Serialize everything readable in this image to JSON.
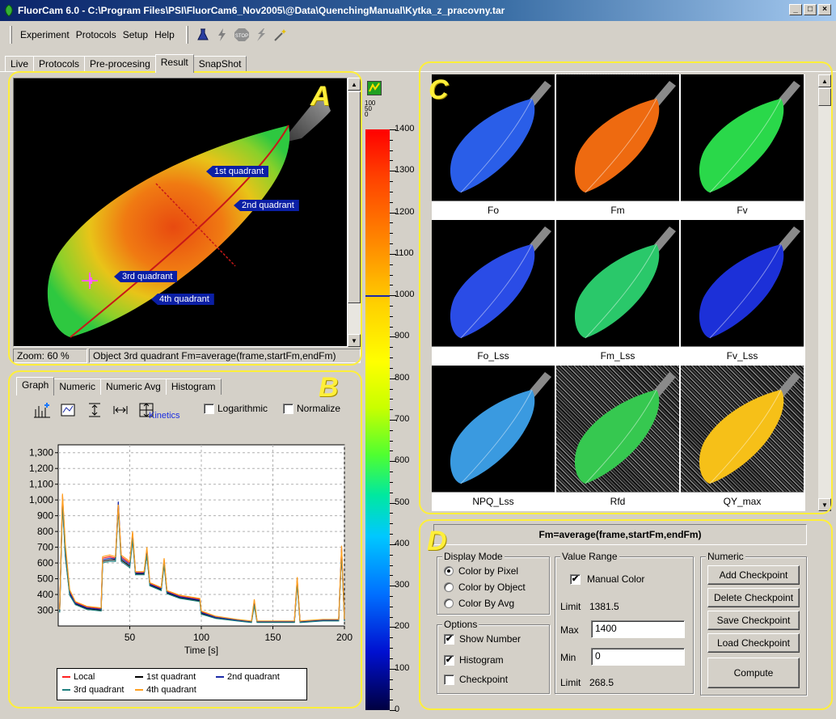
{
  "window": {
    "title": "FluorCam 6.0 - C:\\Program Files\\PSI\\FluorCam6_Nov2005\\@Data\\QuenchingManual\\Kytka_z_pracovny.tar",
    "min": "_",
    "max": "□",
    "close": "×"
  },
  "menu": [
    "Experiment",
    "Protocols",
    "Setup",
    "Help"
  ],
  "toolbar_icons": [
    "flask-icon",
    "flash-icon",
    "stop-icon",
    "lightning-icon",
    "wand-icon"
  ],
  "toolbar": {
    "stop_label": "STOP"
  },
  "main_tabs": [
    "Live",
    "Protocols",
    "Pre-procesing",
    "Result",
    "SnapShot"
  ],
  "active_main_tab": "Result",
  "panel_letters": {
    "a": "A",
    "b": "B",
    "c": "C",
    "d": "D"
  },
  "image_panel": {
    "quadrants": [
      "1st quadrant",
      "2nd quadrant",
      "3rd quadrant",
      "4th quadrant"
    ],
    "zoom": "Zoom: 60 %",
    "object_status": "Object 3rd quadrant  Fm=average(frame,startFm,endFm)"
  },
  "colorscale": {
    "icon_mini_labels": [
      "100",
      "50",
      "0"
    ],
    "ticks": [
      "1400",
      "1300",
      "1200",
      "1100",
      "1000",
      "900",
      "800",
      "700",
      "600",
      "500",
      "400",
      "300",
      "200",
      "100",
      "0"
    ],
    "min": 0,
    "max": 1400,
    "marker_value": 1000
  },
  "graph_panel": {
    "tabs": [
      "Graph",
      "Numeric",
      "Numeric Avg",
      "Histogram"
    ],
    "active_tab": "Graph",
    "kinetics_label": "Kinetics",
    "logarithmic_label": "Logarithmic",
    "normalize_label": "Normalize",
    "logarithmic": false,
    "normalize": false
  },
  "chart_data": {
    "type": "line",
    "xlabel": "Time [s]",
    "ylabel": "",
    "xlim": [
      0,
      200
    ],
    "ylim": [
      200,
      1350
    ],
    "x_ticks": [
      50,
      100,
      150,
      200
    ],
    "y_ticks": [
      "1,300",
      "1,200",
      "1,100",
      "1,000",
      "900",
      "800",
      "700",
      "600",
      "500",
      "400",
      "300"
    ],
    "y_tick_values": [
      1300,
      1200,
      1100,
      1000,
      900,
      800,
      700,
      600,
      500,
      400,
      300
    ],
    "grid": true,
    "legend_position": "bottom",
    "series": [
      {
        "name": "Local",
        "color": "#ff2020",
        "points": [
          [
            1,
            300
          ],
          [
            3,
            1030
          ],
          [
            5,
            700
          ],
          [
            8,
            420
          ],
          [
            12,
            350
          ],
          [
            20,
            320
          ],
          [
            30,
            310
          ],
          [
            31,
            630
          ],
          [
            36,
            640
          ],
          [
            40,
            630
          ],
          [
            42,
            980
          ],
          [
            44,
            640
          ],
          [
            50,
            600
          ],
          [
            52,
            790
          ],
          [
            54,
            540
          ],
          [
            60,
            540
          ],
          [
            62,
            690
          ],
          [
            64,
            470
          ],
          [
            72,
            440
          ],
          [
            74,
            620
          ],
          [
            76,
            420
          ],
          [
            85,
            390
          ],
          [
            99,
            370
          ],
          [
            100,
            290
          ],
          [
            110,
            260
          ],
          [
            125,
            240
          ],
          [
            135,
            230
          ],
          [
            137,
            360
          ],
          [
            139,
            230
          ],
          [
            150,
            230
          ],
          [
            165,
            230
          ],
          [
            167,
            500
          ],
          [
            169,
            230
          ],
          [
            185,
            240
          ],
          [
            196,
            240
          ],
          [
            198,
            700
          ],
          [
            200,
            240
          ]
        ]
      },
      {
        "name": "1st quadrant",
        "color": "#000000",
        "points": [
          [
            1,
            290
          ],
          [
            3,
            1010
          ],
          [
            5,
            650
          ],
          [
            8,
            400
          ],
          [
            12,
            340
          ],
          [
            20,
            310
          ],
          [
            30,
            300
          ],
          [
            31,
            610
          ],
          [
            36,
            620
          ],
          [
            40,
            620
          ],
          [
            42,
            960
          ],
          [
            44,
            620
          ],
          [
            50,
            580
          ],
          [
            52,
            760
          ],
          [
            54,
            530
          ],
          [
            60,
            530
          ],
          [
            62,
            660
          ],
          [
            64,
            460
          ],
          [
            72,
            430
          ],
          [
            74,
            600
          ],
          [
            76,
            410
          ],
          [
            85,
            380
          ],
          [
            99,
            360
          ],
          [
            100,
            280
          ],
          [
            110,
            250
          ],
          [
            125,
            235
          ],
          [
            135,
            225
          ],
          [
            137,
            340
          ],
          [
            139,
            225
          ],
          [
            150,
            225
          ],
          [
            165,
            225
          ],
          [
            167,
            480
          ],
          [
            169,
            225
          ],
          [
            185,
            235
          ],
          [
            196,
            235
          ],
          [
            198,
            680
          ],
          [
            200,
            235
          ]
        ]
      },
      {
        "name": "2nd quadrant",
        "color": "#1b2aa8",
        "points": [
          [
            1,
            295
          ],
          [
            3,
            990
          ],
          [
            5,
            660
          ],
          [
            8,
            410
          ],
          [
            12,
            345
          ],
          [
            20,
            315
          ],
          [
            30,
            305
          ],
          [
            31,
            620
          ],
          [
            36,
            630
          ],
          [
            40,
            625
          ],
          [
            42,
            990
          ],
          [
            44,
            630
          ],
          [
            50,
            590
          ],
          [
            52,
            775
          ],
          [
            54,
            535
          ],
          [
            60,
            535
          ],
          [
            62,
            670
          ],
          [
            64,
            465
          ],
          [
            72,
            435
          ],
          [
            74,
            610
          ],
          [
            76,
            415
          ],
          [
            85,
            385
          ],
          [
            99,
            365
          ],
          [
            100,
            285
          ],
          [
            110,
            255
          ],
          [
            125,
            238
          ],
          [
            135,
            228
          ],
          [
            137,
            350
          ],
          [
            139,
            228
          ],
          [
            150,
            228
          ],
          [
            165,
            228
          ],
          [
            167,
            490
          ],
          [
            169,
            228
          ],
          [
            185,
            238
          ],
          [
            196,
            238
          ],
          [
            198,
            690
          ],
          [
            200,
            238
          ]
        ]
      },
      {
        "name": "3rd quadrant",
        "color": "#208080",
        "points": [
          [
            1,
            285
          ],
          [
            3,
            980
          ],
          [
            5,
            640
          ],
          [
            8,
            395
          ],
          [
            12,
            335
          ],
          [
            20,
            305
          ],
          [
            30,
            295
          ],
          [
            31,
            600
          ],
          [
            36,
            610
          ],
          [
            40,
            610
          ],
          [
            42,
            940
          ],
          [
            44,
            610
          ],
          [
            50,
            570
          ],
          [
            52,
            750
          ],
          [
            54,
            525
          ],
          [
            60,
            525
          ],
          [
            62,
            650
          ],
          [
            64,
            455
          ],
          [
            72,
            425
          ],
          [
            74,
            590
          ],
          [
            76,
            405
          ],
          [
            85,
            375
          ],
          [
            99,
            355
          ],
          [
            100,
            275
          ],
          [
            110,
            248
          ],
          [
            125,
            232
          ],
          [
            135,
            222
          ],
          [
            137,
            330
          ],
          [
            139,
            222
          ],
          [
            150,
            222
          ],
          [
            165,
            222
          ],
          [
            167,
            470
          ],
          [
            169,
            222
          ],
          [
            185,
            232
          ],
          [
            196,
            232
          ],
          [
            198,
            670
          ],
          [
            200,
            232
          ]
        ]
      },
      {
        "name": "4th quadrant",
        "color": "#ffa020",
        "points": [
          [
            1,
            305
          ],
          [
            3,
            1040
          ],
          [
            5,
            720
          ],
          [
            8,
            430
          ],
          [
            12,
            355
          ],
          [
            20,
            325
          ],
          [
            30,
            315
          ],
          [
            31,
            640
          ],
          [
            36,
            650
          ],
          [
            40,
            640
          ],
          [
            42,
            970
          ],
          [
            44,
            650
          ],
          [
            50,
            610
          ],
          [
            52,
            800
          ],
          [
            54,
            545
          ],
          [
            60,
            545
          ],
          [
            62,
            700
          ],
          [
            64,
            475
          ],
          [
            72,
            445
          ],
          [
            74,
            630
          ],
          [
            76,
            425
          ],
          [
            85,
            395
          ],
          [
            99,
            375
          ],
          [
            100,
            295
          ],
          [
            110,
            262
          ],
          [
            125,
            242
          ],
          [
            135,
            232
          ],
          [
            137,
            370
          ],
          [
            139,
            232
          ],
          [
            150,
            232
          ],
          [
            165,
            232
          ],
          [
            167,
            510
          ],
          [
            169,
            232
          ],
          [
            185,
            242
          ],
          [
            196,
            242
          ],
          [
            198,
            710
          ],
          [
            200,
            242
          ]
        ]
      }
    ]
  },
  "thumbnails": {
    "labels": [
      "Fo",
      "Fm",
      "Fv",
      "Fo_Lss",
      "Fm_Lss",
      "Fv_Lss",
      "NPQ_Lss",
      "Rfd",
      "QY_max"
    ],
    "colors": [
      "#2a5ee8",
      "#ee6a10",
      "#2ad84a",
      "#2a4ce6",
      "#2ac86a",
      "#1c30d8",
      "#3a9ae0",
      "#36c850",
      "#f6c018"
    ]
  },
  "controls": {
    "formula": "Fm=average(frame,startFm,endFm)",
    "display_mode": {
      "title": "Display Mode",
      "options": [
        "Color by Pixel",
        "Color by Object",
        "Color By Avg"
      ],
      "selected": "Color by Pixel"
    },
    "options": {
      "title": "Options",
      "show_number": "Show Number",
      "histogram": "Histogram",
      "checkpoint": "Checkpoint",
      "show_number_checked": true,
      "histogram_checked": true,
      "checkpoint_checked": false
    },
    "value_range": {
      "title": "Value Range",
      "manual_color": "Manual Color",
      "manual_color_checked": true,
      "limit_label": "Limit",
      "limit_high": "1381.5",
      "max_label": "Max",
      "max_value": "1400",
      "min_label": "Min",
      "min_value": "0",
      "limit_low": "268.5"
    },
    "numeric": {
      "title": "Numeric",
      "add": "Add Checkpoint",
      "delete": "Delete Checkpoint",
      "save": "Save Checkpoint",
      "load": "Load Checkpoint",
      "compute": "Compute"
    }
  },
  "check_mark": "✔"
}
